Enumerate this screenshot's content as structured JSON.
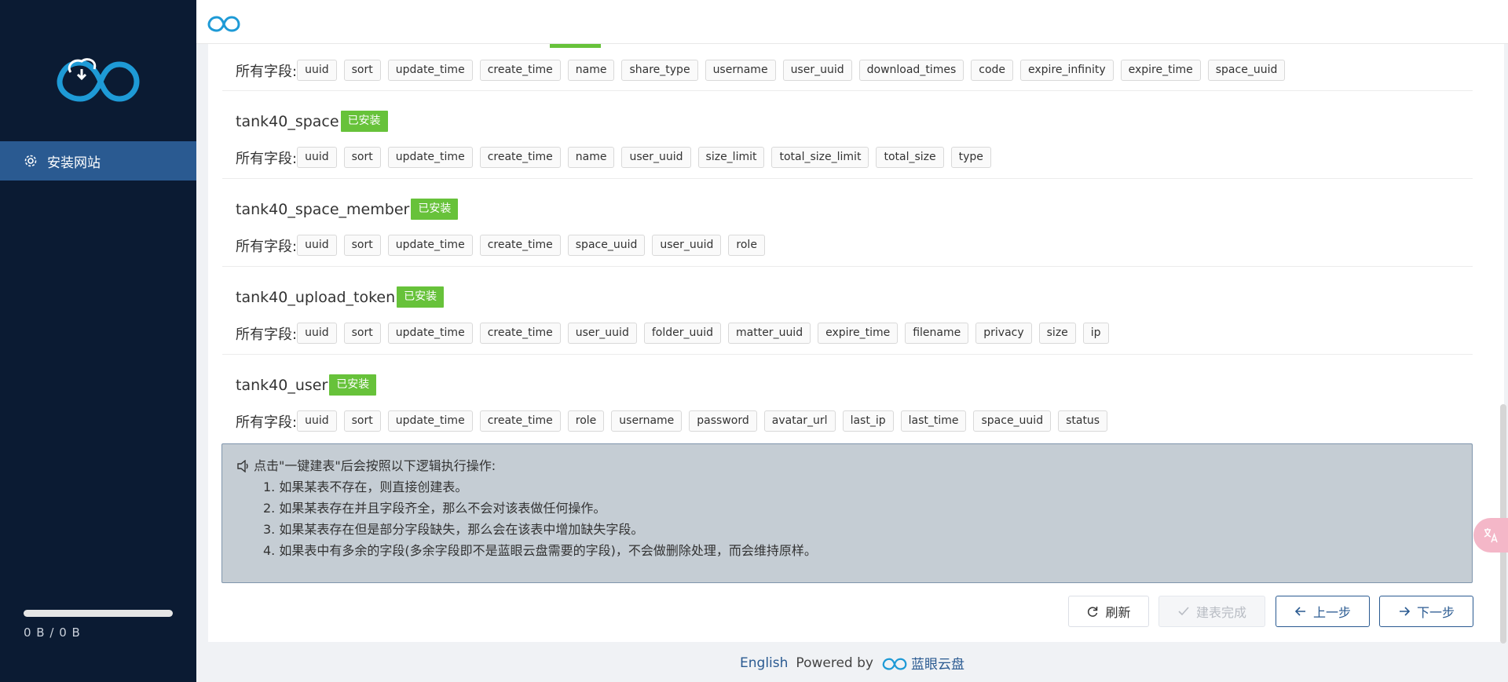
{
  "sidebar": {
    "menu_item": "安装网站",
    "storage": "0 B / 0 B"
  },
  "fields_label": "所有字段:",
  "installed_badge": "已安装",
  "tables": [
    {
      "name": "",
      "fields": [
        "uuid",
        "sort",
        "update_time",
        "create_time",
        "name",
        "share_type",
        "username",
        "user_uuid",
        "download_times",
        "code",
        "expire_infinity",
        "expire_time",
        "space_uuid"
      ]
    },
    {
      "name": "tank40_space",
      "fields": [
        "uuid",
        "sort",
        "update_time",
        "create_time",
        "name",
        "user_uuid",
        "size_limit",
        "total_size_limit",
        "total_size",
        "type"
      ]
    },
    {
      "name": "tank40_space_member",
      "fields": [
        "uuid",
        "sort",
        "update_time",
        "create_time",
        "space_uuid",
        "user_uuid",
        "role"
      ]
    },
    {
      "name": "tank40_upload_token",
      "fields": [
        "uuid",
        "sort",
        "update_time",
        "create_time",
        "user_uuid",
        "folder_uuid",
        "matter_uuid",
        "expire_time",
        "filename",
        "privacy",
        "size",
        "ip"
      ]
    },
    {
      "name": "tank40_user",
      "fields": [
        "uuid",
        "sort",
        "update_time",
        "create_time",
        "role",
        "username",
        "password",
        "avatar_url",
        "last_ip",
        "last_time",
        "space_uuid",
        "status"
      ]
    }
  ],
  "notice": {
    "title": "点击\"一键建表\"后会按照以下逻辑执行操作:",
    "items": [
      "1. 如果某表不存在，则直接创建表。",
      "2. 如果某表存在并且字段齐全，那么不会对该表做任何操作。",
      "3. 如果某表存在但是部分字段缺失，那么会在该表中增加缺失字段。",
      "4. 如果表中有多余的字段(多余字段即不是蓝眼云盘需要的字段)，不会做删除处理，而会维持原样。"
    ]
  },
  "buttons": {
    "refresh": "刷新",
    "done": "建表完成",
    "prev": "上一步",
    "next": "下一步"
  },
  "footer": {
    "language": "English",
    "powered_by": "Powered by",
    "brand": "蓝眼云盘"
  },
  "colors": {
    "sidebar_bg": "#0b1b33",
    "accent": "#2a5a91",
    "badge": "#67c23a",
    "logo_blue": "#1e9ad6"
  }
}
